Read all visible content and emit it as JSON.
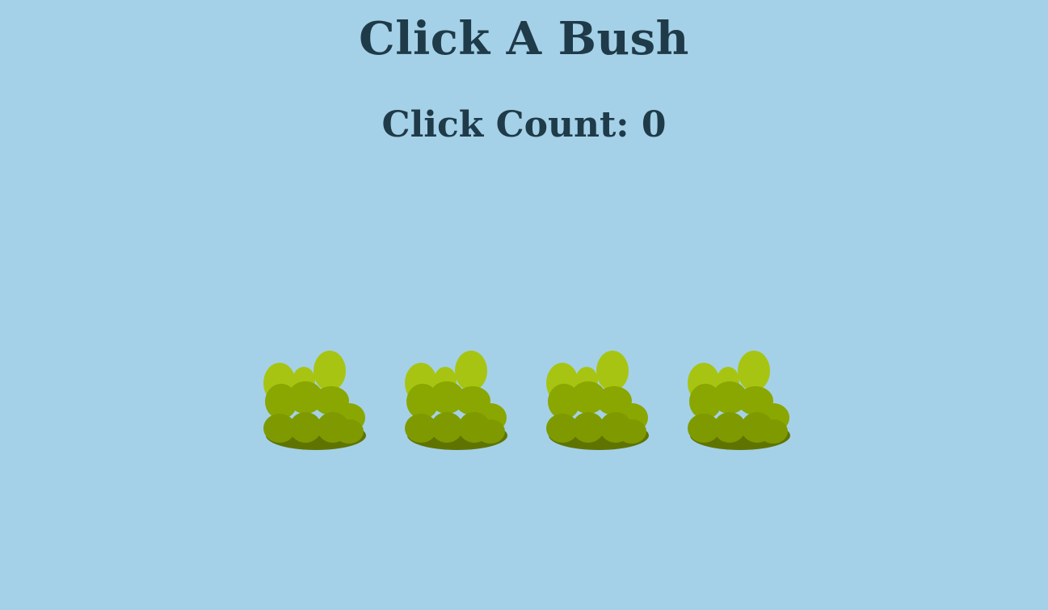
{
  "game": {
    "title": "Click A Bush",
    "counter_label": "Click Count: ",
    "click_count": 0
  },
  "bushes": [
    {
      "name": "bush-1"
    },
    {
      "name": "bush-2"
    },
    {
      "name": "bush-3"
    },
    {
      "name": "bush-4"
    }
  ],
  "colors": {
    "background": "#a4d1e8",
    "text": "#1f3a48",
    "bush_light": "#a7c412",
    "bush_mid": "#8aa600",
    "bush_dark": "#5f7400"
  }
}
